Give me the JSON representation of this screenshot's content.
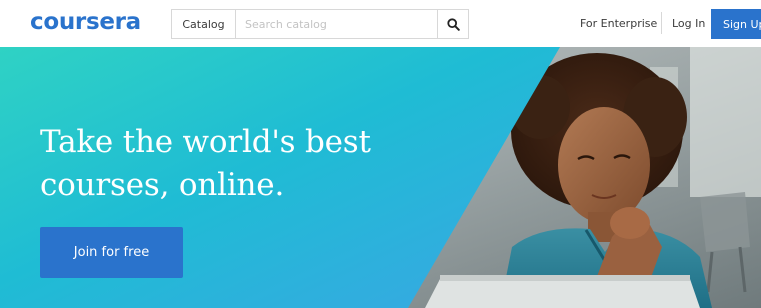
{
  "header": {
    "logo_text": "coursera",
    "search": {
      "catalog_label": "Catalog",
      "placeholder": "Search catalog",
      "value": ""
    },
    "nav": {
      "enterprise_label": "For Enterprise",
      "login_label": "Log In",
      "signup_label": "Sign Up"
    }
  },
  "hero": {
    "title_line1": "Take the world's best",
    "title_line2": "courses, online.",
    "cta_label": "Join for free"
  },
  "colors": {
    "brand_blue": "#2a73cc",
    "gradient_teal": "#2fd2c4",
    "gradient_cyan": "#1fb9d4",
    "gradient_sky": "#3aa6e4"
  },
  "icons": {
    "search": "search-icon"
  }
}
